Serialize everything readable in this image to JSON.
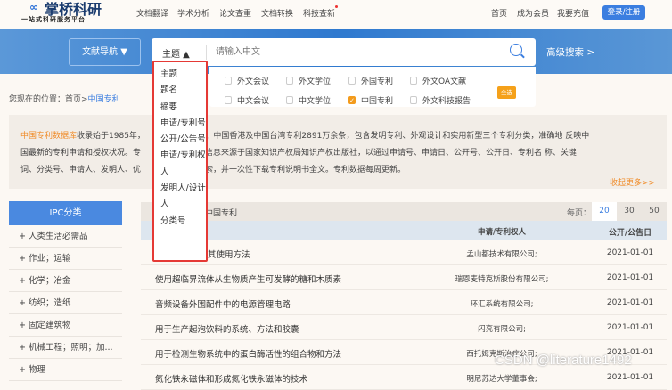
{
  "header": {
    "logo": "掌桥科研",
    "slogan": "一站式科研服务平台",
    "nav": [
      "文档翻译",
      "学术分析",
      "论文查重",
      "文档转换",
      "科技查新"
    ],
    "right": [
      "首页",
      "成为会员",
      "我要充值"
    ],
    "login": "登录/注册"
  },
  "search": {
    "nav_button": "文献导航 ▼",
    "field": "主题 ▲",
    "placeholder": "请输入中文",
    "advanced": "高级搜索 >",
    "dropdown": [
      "主题",
      "题名",
      "摘要",
      "申请/专利号",
      "公开/公告号",
      "申请/专利权人",
      "发明人/设计人",
      "分类号"
    ],
    "checkboxes": [
      {
        "label": "外文会议",
        "checked": false
      },
      {
        "label": "外文学位",
        "checked": false
      },
      {
        "label": "外国专利",
        "checked": false
      },
      {
        "label": "外文OA文献",
        "checked": false
      },
      {
        "label": "中文会议",
        "checked": false
      },
      {
        "label": "中文学位",
        "checked": false
      },
      {
        "label": "中国专利",
        "checked": true
      },
      {
        "label": "外文科技报告",
        "checked": false
      }
    ],
    "select_all": "全选"
  },
  "breadcrumb": {
    "prefix": "您现在的位置：首页>",
    "current": "中国专利"
  },
  "description": {
    "highlight": "中国专利数据库",
    "line1": "收录始于1985年，　　　　　国大陆、中国香港及中国台湾专利2891万余条，包含发明专利、外观设计和实用新型三个专利分类，准确地 反映中",
    "line2": "国最新的专利申请和授权状况。专　　　　　成果等信息来源于国家知识产权局知识产权出版社，以通过申请号、申请日、公开号、公开日、专利名 称、关键",
    "line3": "词、分类号、申请人、发明人、优　　　　　进行检索，并一次性下载专利说明书全文。专利数据每周更新。",
    "more": "收起更多>>"
  },
  "sidebar": {
    "title": "IPC分类",
    "items": [
      "+ 人类生活必需品",
      "+ 作业；运输",
      "+ 化学；冶金",
      "+ 纺织；造纸",
      "+ 固定建筑物",
      "+ 机械工程；照明；加...",
      "+ 物理"
    ]
  },
  "table": {
    "title": "中国专利",
    "per_page_label": "每页：",
    "page_sizes": [
      "20",
      "30",
      "50"
    ],
    "columns": [
      "申请/专利权人",
      "公开/公告日"
    ],
    "rows": [
      {
        "title": "其使用方法",
        "owner": "孟山都技术有限公司;",
        "date": "2021-01-01"
      },
      {
        "title": "使用超临界流体从生物质产生可发酵的糖和木质素",
        "owner": "瑞恩麦特克斯股份有限公司;",
        "date": "2021-01-01"
      },
      {
        "title": "音频设备外围配件中的电源管理电路",
        "owner": "环汇系统有限公司;",
        "date": "2021-01-01"
      },
      {
        "title": "用于生产起泡饮料的系统、方法和胶囊",
        "owner": "闪亮有限公司;",
        "date": "2021-01-01"
      },
      {
        "title": "用于检测生物系统中的蛋白酶活性的组合物和方法",
        "owner": "西托姆克斯治疗公司;",
        "date": "2021-01-01"
      },
      {
        "title": "氮化铁永磁体和形成氮化铁永磁体的技术",
        "owner": "明尼苏达大学董事会;",
        "date": "2021-01-01"
      }
    ]
  },
  "watermark": "CSDN @literature1492"
}
